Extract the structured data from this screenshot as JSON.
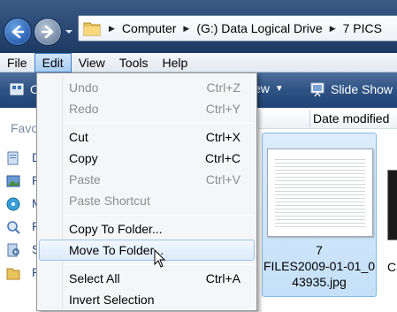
{
  "address": {
    "breadcrumbs": [
      "Computer",
      "(G:) Data Logical Drive",
      "7 PICS"
    ]
  },
  "menubar": {
    "items": [
      {
        "label": "File",
        "active": false
      },
      {
        "label": "Edit",
        "active": true
      },
      {
        "label": "View",
        "active": false
      },
      {
        "label": "Tools",
        "active": false
      },
      {
        "label": "Help",
        "active": false
      }
    ]
  },
  "toolbar": {
    "organize_label": "O",
    "views_label": "ew",
    "slideshow_label": "Slide Show"
  },
  "columns": {
    "date_modified": "Date modified"
  },
  "navpane": {
    "favorites_label": "Favo",
    "items": [
      "D",
      "P",
      "M",
      "P",
      "S",
      "P"
    ]
  },
  "edit_menu": {
    "items": [
      {
        "label": "Undo",
        "shortcut": "Ctrl+Z",
        "disabled": true
      },
      {
        "label": "Redo",
        "shortcut": "Ctrl+Y",
        "disabled": true
      },
      {
        "label": "Cut",
        "shortcut": "Ctrl+X",
        "disabled": false
      },
      {
        "label": "Copy",
        "shortcut": "Ctrl+C",
        "disabled": false
      },
      {
        "label": "Paste",
        "shortcut": "Ctrl+V",
        "disabled": true
      },
      {
        "label": "Paste Shortcut",
        "shortcut": "",
        "disabled": true
      },
      {
        "label": "Copy To Folder...",
        "shortcut": "",
        "disabled": false
      },
      {
        "label": "Move To Folder...",
        "shortcut": "",
        "disabled": false,
        "hover": true
      },
      {
        "label": "Select All",
        "shortcut": "Ctrl+A",
        "disabled": false
      },
      {
        "label": "Invert Selection",
        "shortcut": "",
        "disabled": false
      }
    ]
  },
  "files": [
    {
      "name_line1": "7",
      "name_line2": "FILES2009-01-01_0",
      "name_line3": "43935.jpg",
      "selected": true
    },
    {
      "name_partial": "C"
    }
  ],
  "colors": {
    "menu_hover_border": "#9fc2ea",
    "selection_bg": "#c5e0f8",
    "toolbar_bg": "#2e5283"
  }
}
